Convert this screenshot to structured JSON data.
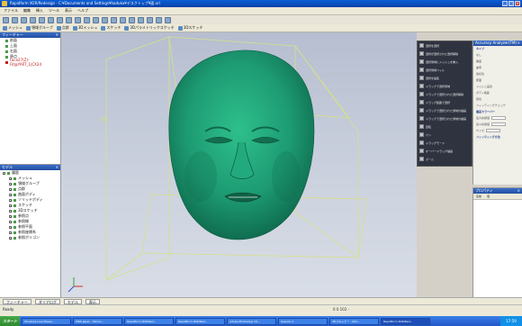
{
  "window": {
    "title": "Rapidform XOR/Redesign - C:¥Documents and Settings¥haduka¥デスクトップ¥面.xrl"
  },
  "menu": [
    "ファイル",
    "編集",
    "挿入",
    "ツール",
    "表示",
    "ヘルプ"
  ],
  "toolbar2": [
    "メッシュ",
    "領域グループ",
    "点群",
    "3Dメッシュ",
    "スケッチ",
    "3Dパラメトリックスケッチ",
    "3Dスケッチ"
  ],
  "feature_tree": {
    "title": "フィーチャー",
    "items": [
      "前面",
      "上面",
      "右面",
      "原点"
    ],
    "highlighted": "Face27(Z)-Fit@YART_1|CX2d"
  },
  "model_tree": {
    "title": "モデル",
    "root": "履歴",
    "items": [
      "メッシュ",
      "領域グループ",
      "点群",
      "曲面ボディ",
      "ソリッドボディ",
      "スケッチ",
      "3Dスケッチ",
      "参照点",
      "参照線",
      "参照平面",
      "参照座標系",
      "参照ポリゴン"
    ]
  },
  "viewport": {
    "plane_label": "右面"
  },
  "command_panel": {
    "items": [
      "選択を選択",
      "選択が選択された選択解除",
      "選択領域にメッシュを挿入",
      "選択領域フィル",
      "選択を編集",
      "ドラッグで選択領域",
      "ドラッグで選択された選択解除",
      "ドラッグ範囲で選択",
      "ドラッグで選択された領域の描画",
      "ドラッグで選択された領域の描画",
      "回転",
      "パン",
      "ドラッグモード",
      "オーバードラッグ描画",
      "ズーム"
    ]
  },
  "accuracy_panel": {
    "title": "Accuracy Analyzer(TM)",
    "sections": [
      "タイプ",
      "なし",
      "偏差",
      "曲率",
      "連続性",
      "断面",
      "メッシュ品質",
      "ボディ偏差",
      "環境",
      "フィッティングチェック",
      "偏差カラーバー",
      "最大許容値",
      "最小許容値",
      "サイズ",
      "フィッティング方法"
    ]
  },
  "property_panel": {
    "title": "プロパティ",
    "cols": [
      "名前",
      "値"
    ]
  },
  "bottom_tabs": [
    "フィーチャー",
    "ダイアログ",
    "モデル",
    "表示"
  ],
  "status": {
    "ready": "Ready",
    "coords": "0 0 102 -"
  },
  "taskbar": {
    "start": "スタート",
    "tasks": [
      "Windows Live Messe...",
      "MSN Japan - Micros...",
      "Rapidform XOR/Red...",
      "Rapidform XOR/Red...",
      "Adobe Photoshop CS...",
      "Session 1",
      "3Dスキャナー - Micr...",
      "Rapidform XOR/Red..."
    ],
    "clock": "17:59"
  },
  "colors": {
    "mesh": "#1d9a72",
    "viewport_top": "#b6bed0",
    "command_bg": "#2f3340"
  }
}
